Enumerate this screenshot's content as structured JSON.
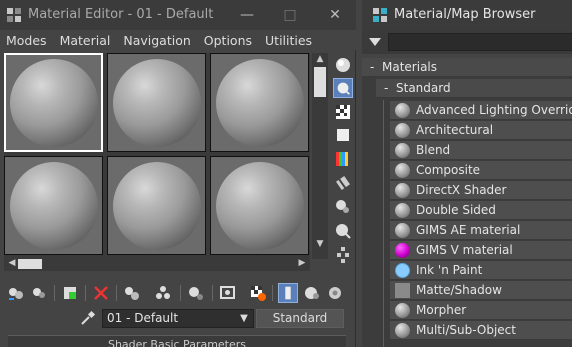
{
  "material_editor": {
    "title": "Material Editor - 01 - Default",
    "window_controls": {
      "minimize": "—",
      "maximize": "□",
      "close": "✕"
    },
    "menu": [
      "Modes",
      "Material",
      "Navigation",
      "Options",
      "Utilities"
    ],
    "active_slot_index": 0,
    "slot_count": 6,
    "side_tools": [
      "sample-type-icon",
      "backlight-icon",
      "background-icon",
      "sample-uv-tiling-icon",
      "video-color-check-icon",
      "make-preview-icon",
      "options-icon",
      "select-by-material-icon",
      "material-map-navigator-icon"
    ],
    "bottom_tools": [
      "get-material-icon",
      "put-to-scene-icon",
      "assign-to-selection-icon",
      "reset-map-icon",
      "make-unique-icon",
      "put-to-library-icon",
      "material-id-channel-icon",
      "show-shaded-in-viewport-icon",
      "show-end-result-icon",
      "go-to-parent-icon",
      "go-forward-to-sibling-icon",
      "go-to-sibling-icon"
    ],
    "material_name": "01 - Default",
    "material_type_button": "Standard",
    "rollout_title": "Shader Basic Parameters"
  },
  "browser": {
    "title": "Material/Map Browser",
    "search_placeholder": "",
    "group": "Materials",
    "subgroup": "Standard",
    "items": [
      {
        "label": "Advanced Lighting Override",
        "swatch": "#9a9a9a"
      },
      {
        "label": "Architectural",
        "swatch": "#9a9a9a"
      },
      {
        "label": "Blend",
        "swatch": "#9a9a9a"
      },
      {
        "label": "Composite",
        "swatch": "#9a9a9a"
      },
      {
        "label": "DirectX Shader",
        "swatch": "#9a9a9a"
      },
      {
        "label": "Double Sided",
        "swatch": "#9a9a9a"
      },
      {
        "label": "GIMS AE material",
        "swatch": "#9a9a9a"
      },
      {
        "label": "GIMS V material",
        "swatch": "#cc00cc"
      },
      {
        "label": "Ink 'n Paint",
        "swatch": "#88ccff"
      },
      {
        "label": "Matte/Shadow",
        "swatch": "#8a8a8a"
      },
      {
        "label": "Morpher",
        "swatch": "#9a9a9a"
      },
      {
        "label": "Multi/Sub-Object",
        "swatch": "#9a9a9a"
      }
    ]
  },
  "colors": {
    "accent": "#5b7fb8",
    "panel": "#444444",
    "titlebar": "#3b3b3b"
  }
}
